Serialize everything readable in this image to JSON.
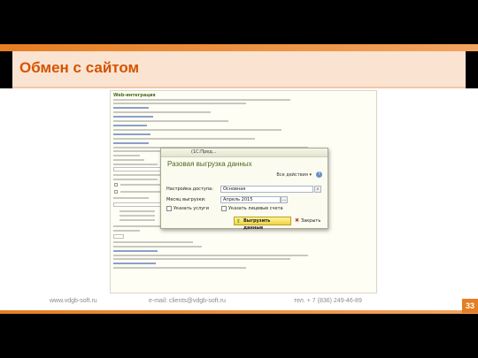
{
  "slide": {
    "title": "Обмен с сайтом",
    "page_number": "33"
  },
  "footer": {
    "website": "www.vdgb-soft.ru",
    "email": "e-mail: clients@vdgb-soft.ru",
    "phone": "тел. + 7 (836) 249-46-89"
  },
  "document": {
    "heading": "Web-интеграция"
  },
  "dialog": {
    "app_title": "(1С:Пред...",
    "title": "Разовая выгрузка данных",
    "all_actions": "Все действия ▾",
    "help": "?",
    "access_label": "Настройка доступа:",
    "access_value": "Основная",
    "month_label": "Месяц выгрузки:",
    "month_value": "Апрель 2015",
    "services_label": "Указать услуги",
    "accounts_label": "Указать лицевые счета",
    "export_button": "Выгрузить данные",
    "close_button": "Закрыть"
  },
  "colors": {
    "accent": "#e67e22",
    "title": "#d35400",
    "dialog_title": "#4c6b1e"
  }
}
